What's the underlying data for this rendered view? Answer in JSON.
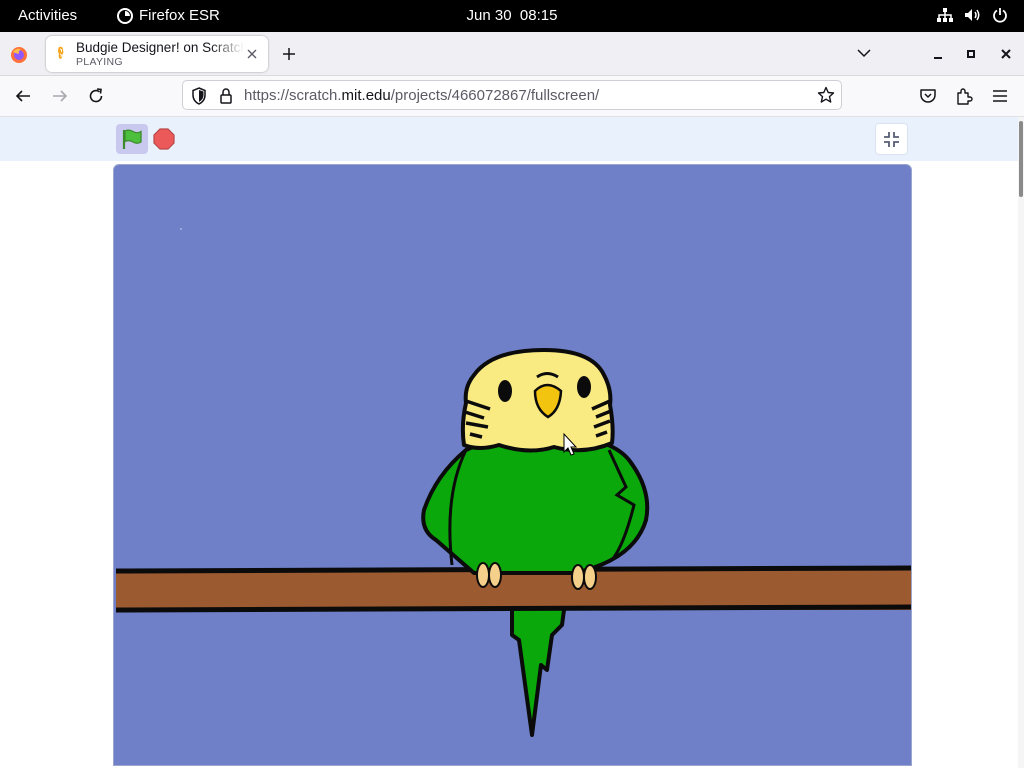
{
  "system_bar": {
    "activities": "Activities",
    "app_name": "Firefox ESR",
    "date": "Jun 30",
    "time": "08:15"
  },
  "tabs": [
    {
      "title": "Budgie Designer! on Scratch",
      "status": "PLAYING",
      "active": true
    }
  ],
  "address_bar": {
    "url_prefix": "https://scratch.",
    "url_domain": "mit.edu",
    "url_path": "/projects/466072867/fullscreen/"
  },
  "scratch_player": {
    "green_flag_active": true,
    "stage_background": "#6f80c9",
    "sprites": [
      "budgie",
      "perch"
    ]
  },
  "colors": {
    "accent": "#4c97ff",
    "budgie_body": "#0aa80a",
    "budgie_head": "#f9ea82",
    "perch": "#9b5a30"
  }
}
